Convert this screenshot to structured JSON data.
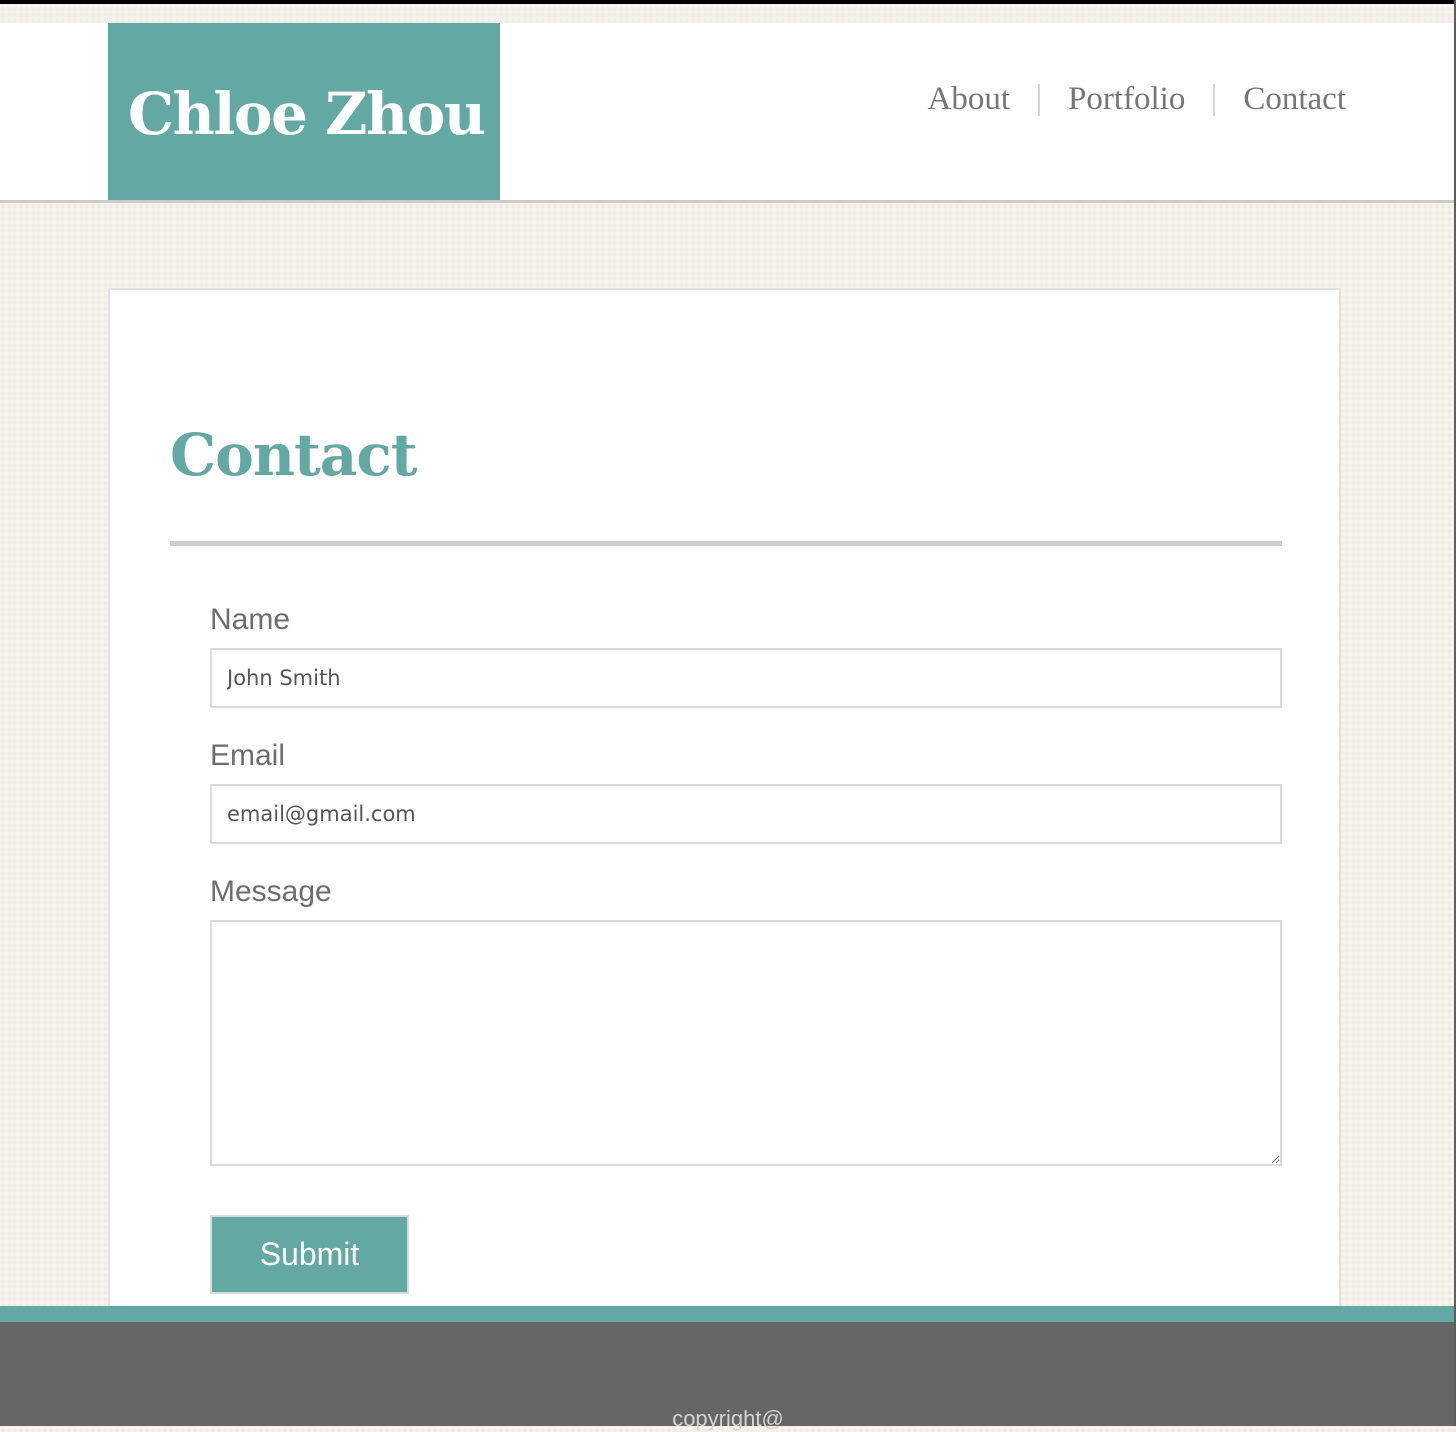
{
  "header": {
    "logo_text": "Chloe Zhou",
    "nav": {
      "about": "About",
      "portfolio": "Portfolio",
      "contact": "Contact"
    }
  },
  "main": {
    "title": "Contact",
    "form": {
      "name_label": "Name",
      "name_placeholder": "John Smith",
      "email_label": "Email",
      "email_placeholder": "email@gmail.com",
      "message_label": "Message",
      "message_value": "",
      "submit_label": "Submit"
    }
  },
  "footer": {
    "text": "copyright@"
  },
  "colors": {
    "accent": "#64a8a4",
    "footer_bg": "#666666",
    "page_bg": "#f3f0ea",
    "text_gray": "#767676"
  }
}
